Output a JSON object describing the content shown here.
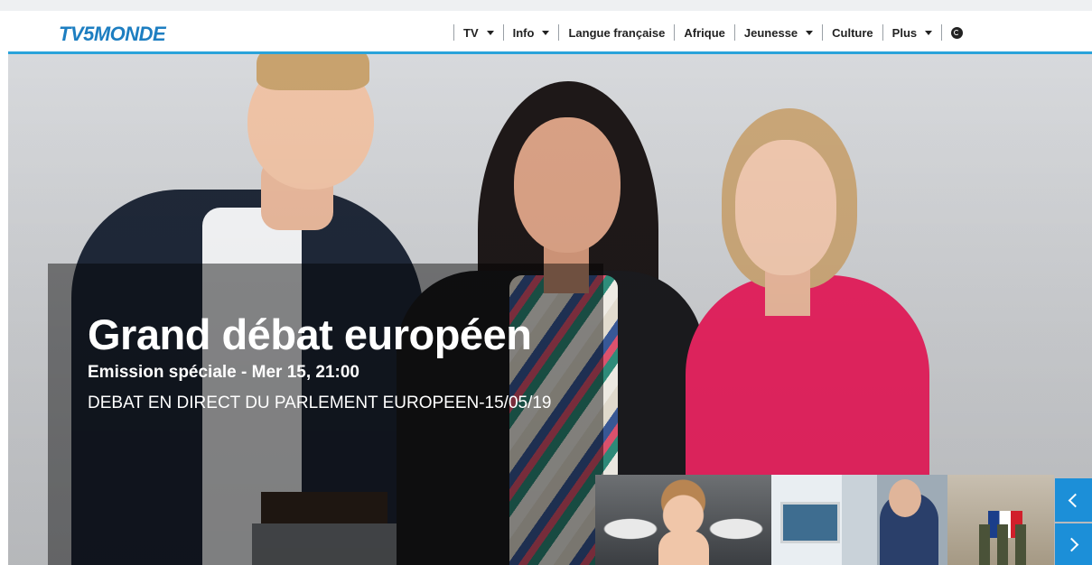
{
  "header": {
    "logo": "TV5MONDE",
    "nav": [
      {
        "label": "TV",
        "dropdown": true
      },
      {
        "label": "Info",
        "dropdown": true
      },
      {
        "label": "Langue française",
        "dropdown": false
      },
      {
        "label": "Afrique",
        "dropdown": false
      },
      {
        "label": "Jeunesse",
        "dropdown": true
      },
      {
        "label": "Culture",
        "dropdown": false
      },
      {
        "label": "Plus",
        "dropdown": true
      }
    ],
    "globe_icon": "globe-icon"
  },
  "hero": {
    "title": "Grand débat européen",
    "subtitle": "Emission spéciale - Mer 15, 21:00",
    "description": "DEBAT EN DIRECT DU PARLEMENT EUROPEEN-15/05/19"
  },
  "carousel": {
    "thumbnails": [
      {
        "subject": "angry-woman-steam"
      },
      {
        "subject": "woman-at-computer-desk"
      },
      {
        "subject": "soldiers-carrying-flag-coffin"
      }
    ],
    "prev_icon": "chevron-left-icon",
    "next_icon": "chevron-right-icon"
  },
  "colors": {
    "brand_blue": "#1d7ec1",
    "accent_blue": "#2aa3da",
    "carousel_button": "#1c8fd8"
  }
}
